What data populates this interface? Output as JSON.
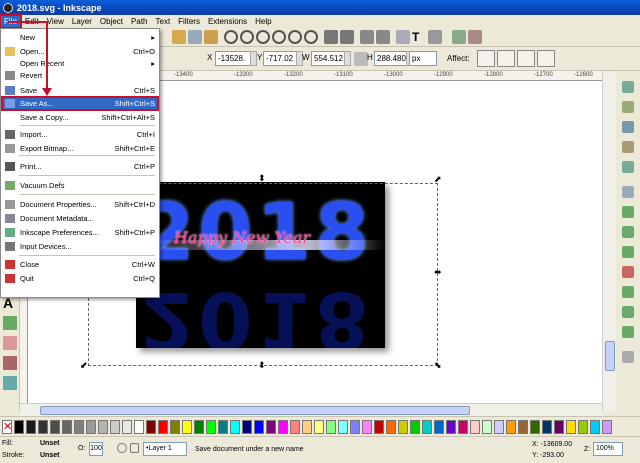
{
  "window": {
    "title": "2018.svg - Inkscape"
  },
  "menubar": {
    "items": [
      "File",
      "Edit",
      "View",
      "Layer",
      "Object",
      "Path",
      "Text",
      "Filters",
      "Extensions",
      "Help"
    ]
  },
  "toolbar2": {
    "x_label": "X",
    "x_value": "-13528.",
    "y_label": "Y",
    "y_value": "-717.02",
    "w_label": "W",
    "w_value": "554.512",
    "h_label": "H",
    "h_value": "288.480",
    "unit": "px",
    "affect_label": "Affect:"
  },
  "ruler": {
    "ticks": [
      "-13400",
      "-13300",
      "-13200",
      "-13100",
      "-13000",
      "-12900",
      "-12800",
      "-12700",
      "-12600"
    ]
  },
  "file_menu": {
    "items": [
      {
        "label": "New",
        "shortcut": "",
        "submenu": true,
        "icon": "blank-icon"
      },
      {
        "label": "Open...",
        "shortcut": "Ctrl+O",
        "icon": "folder-open-icon"
      },
      {
        "label": "Open Recent",
        "shortcut": "",
        "submenu": true,
        "icon": "blank-icon"
      },
      {
        "label": "Revert",
        "shortcut": "",
        "icon": "revert-icon"
      },
      {
        "label": "Save",
        "shortcut": "Ctrl+S",
        "icon": "save-icon"
      },
      {
        "label": "Save As...",
        "shortcut": "Shift+Ctrl+S",
        "icon": "save-as-icon",
        "selected": true
      },
      {
        "label": "Save a Copy...",
        "shortcut": "Shift+Ctrl+Alt+S",
        "icon": "blank-icon"
      },
      {
        "label": "Import...",
        "shortcut": "Ctrl+I",
        "icon": "import-icon"
      },
      {
        "label": "Export Bitmap...",
        "shortcut": "Shift+Ctrl+E",
        "icon": "export-icon"
      },
      {
        "label": "Print...",
        "shortcut": "Ctrl+P",
        "icon": "print-icon"
      },
      {
        "label": "Vacuum Defs",
        "shortcut": "",
        "icon": "vacuum-icon"
      },
      {
        "label": "Document Properties...",
        "shortcut": "Shift+Ctrl+D",
        "icon": "document-properties-icon"
      },
      {
        "label": "Document Metadata...",
        "shortcut": "",
        "icon": "metadata-icon"
      },
      {
        "label": "Inkscape Preferences...",
        "shortcut": "Shift+Ctrl+P",
        "icon": "preferences-icon"
      },
      {
        "label": "Input Devices...",
        "shortcut": "",
        "icon": "input-devices-icon"
      },
      {
        "label": "Close",
        "shortcut": "Ctrl+W",
        "icon": "close-icon"
      },
      {
        "label": "Quit",
        "shortcut": "Ctrl+Q",
        "icon": "quit-icon"
      }
    ]
  },
  "artwork": {
    "year": "2018",
    "greeting": "Happy New Year"
  },
  "palette": {
    "colors": [
      "#000000",
      "#1a1a1a",
      "#333333",
      "#4d4d4d",
      "#666666",
      "#808080",
      "#999999",
      "#b3b3b3",
      "#cccccc",
      "#e6e6e6",
      "#ffffff",
      "#800000",
      "#ff0000",
      "#808000",
      "#ffff00",
      "#008000",
      "#00ff00",
      "#008080",
      "#00ffff",
      "#000080",
      "#0000ff",
      "#800080",
      "#ff00ff",
      "#ff8080",
      "#ffcc80",
      "#ffff80",
      "#80ff80",
      "#80ffff",
      "#8080ff",
      "#ff80ff",
      "#c00000",
      "#ff6600",
      "#cccc00",
      "#00cc00",
      "#00cccc",
      "#0066cc",
      "#6600cc",
      "#cc0066",
      "#ffcccc",
      "#ccffcc",
      "#ccccff",
      "#ff9900",
      "#996633",
      "#336600",
      "#003366",
      "#660066",
      "#ffdd00",
      "#99cc00",
      "#00ccff",
      "#cc99ff"
    ]
  },
  "status": {
    "fill_label": "Fill:",
    "fill_value": "Unset",
    "stroke_label": "Stroke:",
    "stroke_value": "Unset",
    "opacity_label": "O:",
    "opacity_value": "100",
    "layer": "•Layer 1",
    "message": "Save document under a new name",
    "x_coord": "X: -13609.00",
    "y_coord": "Y:   -293.00",
    "zoom_label": "Z:",
    "zoom_value": "100%"
  }
}
